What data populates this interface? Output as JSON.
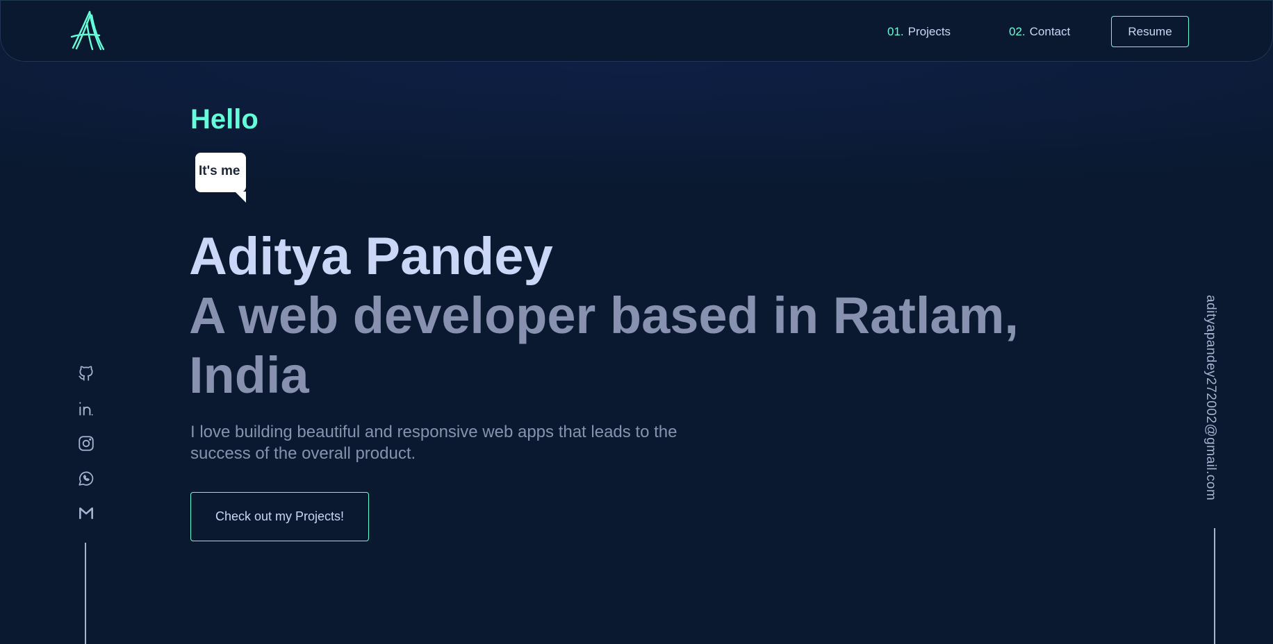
{
  "header": {
    "nav": [
      {
        "num": "01.",
        "label": "Projects"
      },
      {
        "num": "02.",
        "label": "Contact"
      }
    ],
    "resume_label": "Resume"
  },
  "hero": {
    "greeting": "Hello",
    "bubble_text": "It's me",
    "name": "Aditya Pandey",
    "tagline": "A web developer based in Ratlam, India",
    "description": "I love building beautiful and responsive web apps that leads to the success of the overall product.",
    "cta_label": "Check out my Projects!"
  },
  "social": [
    "github-icon",
    "linkedin-icon",
    "instagram-icon",
    "whatsapp-icon",
    "gmail-icon"
  ],
  "email": "adityapandey272002@gmail.com",
  "colors": {
    "background": "#0a192f",
    "accent": "#64ffda",
    "heading": "#ccd6f6",
    "muted": "#8892b0"
  }
}
